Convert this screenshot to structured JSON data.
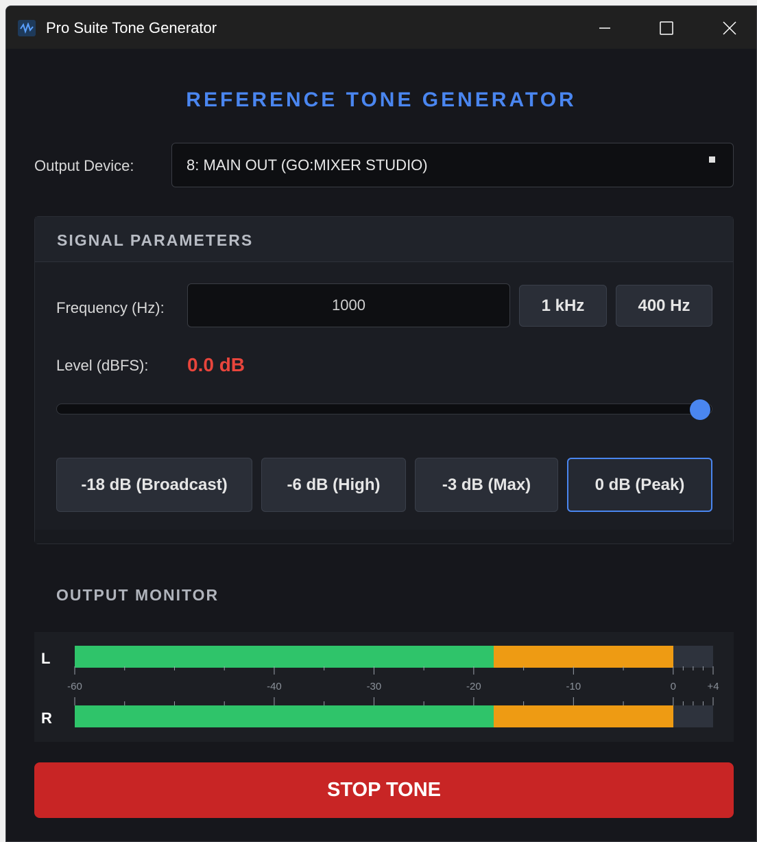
{
  "window": {
    "title": "Pro Suite Tone Generator",
    "icon": "waveform-icon",
    "controls": [
      "minimize-icon",
      "maximize-icon",
      "close-icon"
    ]
  },
  "header": {
    "title": "REFERENCE TONE GENERATOR"
  },
  "device": {
    "label": "Output Device:",
    "selected": "8: MAIN OUT (GO:MIXER STUDIO)"
  },
  "signal": {
    "title": "SIGNAL PARAMETERS",
    "frequency_label": "Frequency (Hz):",
    "frequency_value": "1000",
    "preset_1k": "1 kHz",
    "preset_400": "400 Hz",
    "level_label": "Level (dBFS):",
    "level_display": "0.0 dB",
    "level_db": 0.0,
    "level_min_db": -60,
    "level_max_db": 0,
    "level_presets": [
      "-18 dB (Broadcast)",
      "-6 dB (High)",
      "-3 dB (Max)",
      "0 dB (Peak)"
    ],
    "active_preset_index": 3
  },
  "monitor": {
    "title": "OUTPUT MONITOR",
    "channels": [
      "L",
      "R"
    ],
    "scale_min_db": -60,
    "scale_max_db": 4,
    "scale_labels": [
      "-60",
      "-40",
      "-30",
      "-20",
      "-10",
      "0",
      "+4"
    ],
    "green_until_db": -18,
    "level_db": 0,
    "colors": {
      "green": "#2fc46a",
      "orange": "#ee9b13",
      "empty": "#2e333d"
    }
  },
  "action": {
    "stop_label": "STOP TONE"
  },
  "colors": {
    "accent": "#4a86f0",
    "level_value": "#e8453c",
    "stop": "#c82525"
  }
}
